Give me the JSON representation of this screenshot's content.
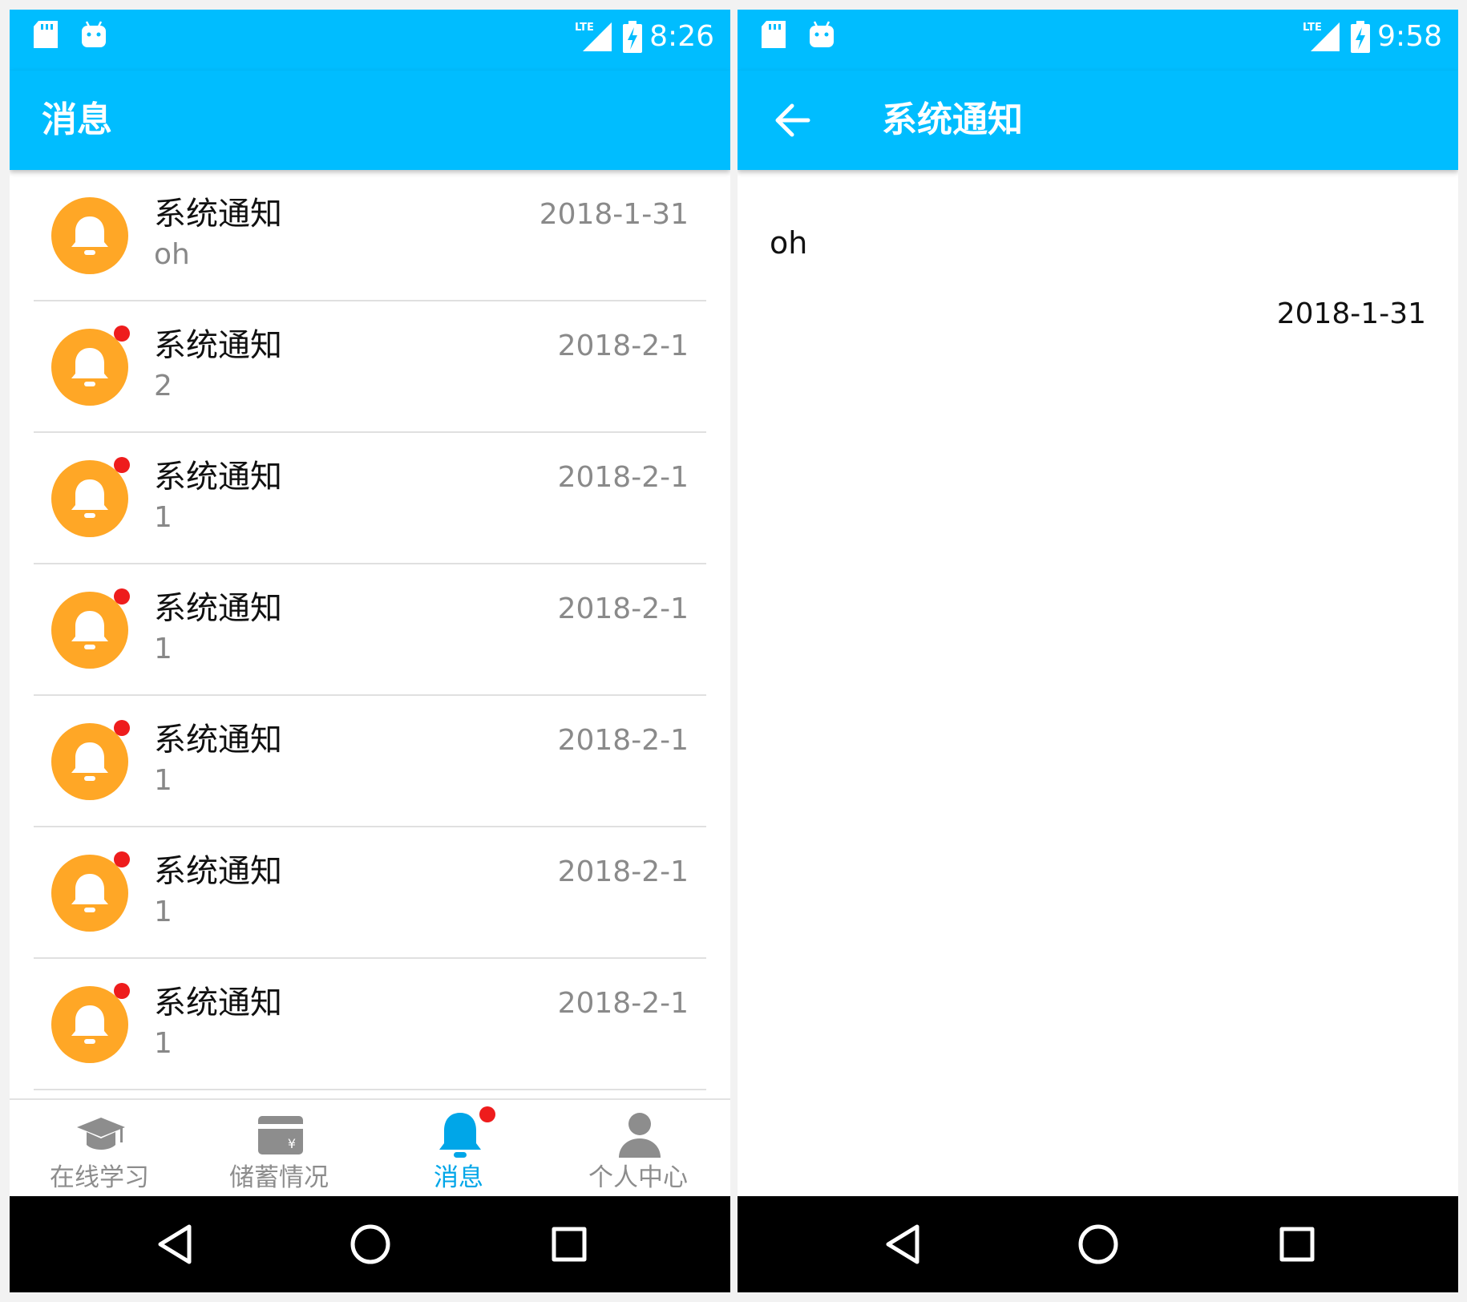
{
  "left": {
    "status": {
      "time": "8:26",
      "network": "LTE"
    },
    "appbar": {
      "title": "消息"
    },
    "messages": [
      {
        "title": "系统通知",
        "subtitle": "oh",
        "date": "2018-1-31",
        "unread": false
      },
      {
        "title": "系统通知",
        "subtitle": "2",
        "date": "2018-2-1",
        "unread": true
      },
      {
        "title": "系统通知",
        "subtitle": "1",
        "date": "2018-2-1",
        "unread": true
      },
      {
        "title": "系统通知",
        "subtitle": "1",
        "date": "2018-2-1",
        "unread": true
      },
      {
        "title": "系统通知",
        "subtitle": "1",
        "date": "2018-2-1",
        "unread": true
      },
      {
        "title": "系统通知",
        "subtitle": "1",
        "date": "2018-2-1",
        "unread": true
      },
      {
        "title": "系统通知",
        "subtitle": "1",
        "date": "2018-2-1",
        "unread": true
      }
    ],
    "tabs": [
      {
        "label": "在线学习",
        "icon": "graduation-cap-icon",
        "active": false
      },
      {
        "label": "储蓄情况",
        "icon": "wallet-yen-icon",
        "active": false
      },
      {
        "label": "消息",
        "icon": "bell-icon",
        "active": true,
        "badge": true
      },
      {
        "label": "个人中心",
        "icon": "person-icon",
        "active": false
      }
    ]
  },
  "right": {
    "status": {
      "time": "9:58",
      "network": "LTE"
    },
    "appbar": {
      "title": "系统通知"
    },
    "detail": {
      "content": "oh",
      "date": "2018-1-31"
    }
  },
  "colors": {
    "primary": "#00bdff",
    "accent_tab": "#00a6e8",
    "avatar": "#ffa726",
    "unread": "#ee1c1c",
    "inactive_tab": "#8d8d8d"
  }
}
